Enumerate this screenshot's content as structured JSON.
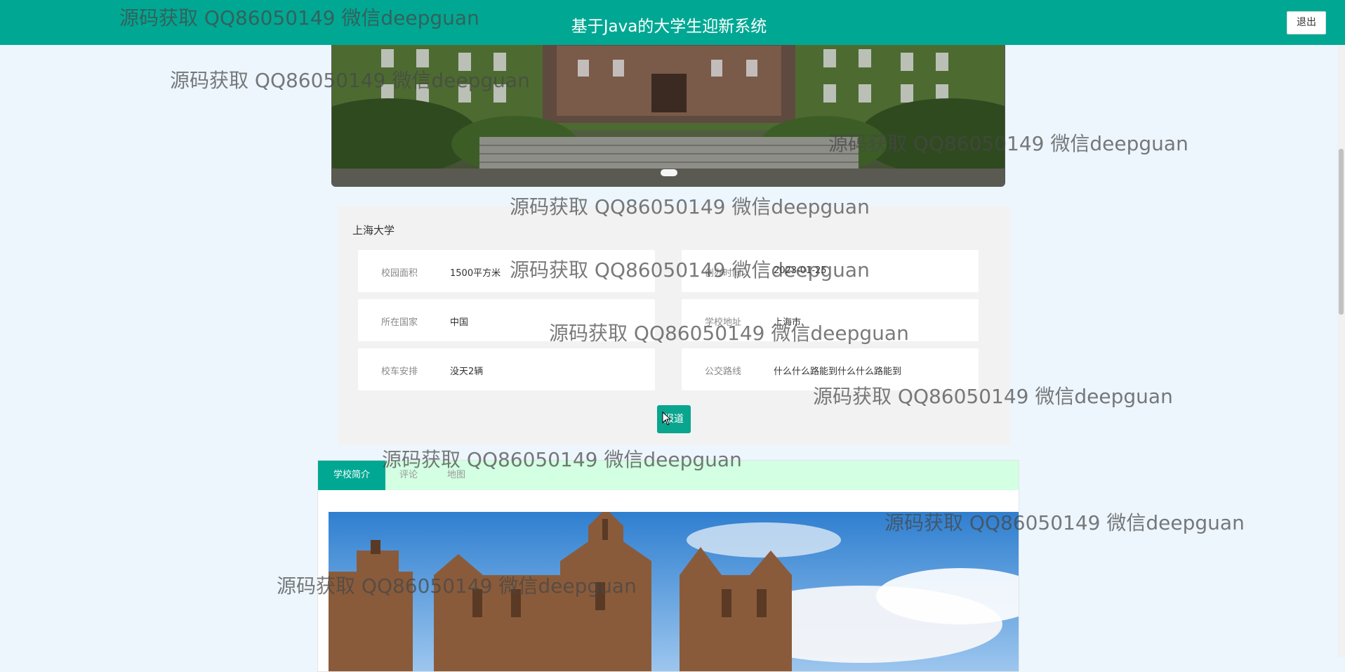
{
  "header": {
    "title": "基于Java的大学生迎新系统",
    "logout_label": "退出",
    "bg_color": "#00a893"
  },
  "school": {
    "name": "上海大学",
    "fields": [
      {
        "label": "校园面积",
        "value": "1500平方米"
      },
      {
        "label": "创办时间",
        "value": "2023-01-25"
      },
      {
        "label": "所在国家",
        "value": "中国"
      },
      {
        "label": "学校地址",
        "value": "上海市"
      },
      {
        "label": "校车安排",
        "value": "没天2辆"
      },
      {
        "label": "公交路线",
        "value": "什么什么路能到什么什么路能到"
      }
    ],
    "report_button": "报道"
  },
  "tabs": [
    {
      "label": "学校简介",
      "active": true
    },
    {
      "label": "评论",
      "active": false
    },
    {
      "label": "地图",
      "active": false
    }
  ],
  "accent_color": "#00a893",
  "tabbar_color": "#d3ffe3",
  "watermark": {
    "text": "源码获取 QQ86050149 微信deepguan"
  }
}
